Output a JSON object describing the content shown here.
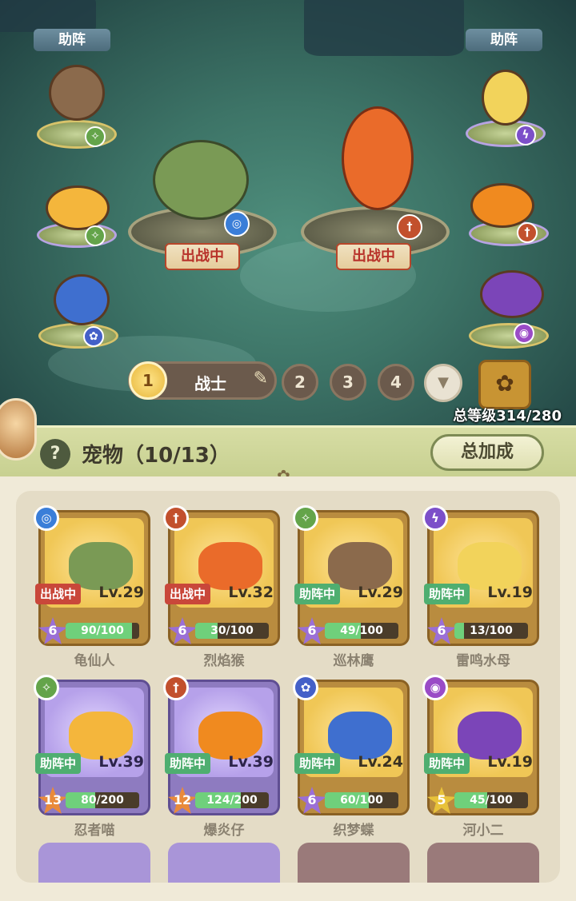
{
  "scene": {
    "assist_label": "助阵",
    "fight_label": "出战中",
    "team": {
      "selected_number": "1",
      "name": "战士",
      "other_numbers": [
        "2",
        "3",
        "4"
      ]
    },
    "total_level": "总等级314/280"
  },
  "panel": {
    "help": "?",
    "title": "宠物（10/13）",
    "bonus_button": "总加成"
  },
  "colors": {
    "fight": "#c9473a",
    "assist": "#4fae70",
    "exp_bar": "#6fd07b"
  },
  "pets": [
    {
      "name": "龟仙人",
      "status": "出战中",
      "level": "Lv.29",
      "star": "6",
      "exp": "90/100",
      "exp_frac": 0.9,
      "element_icon": "water-icon",
      "rarity": "gold"
    },
    {
      "name": "烈焰猴",
      "status": "出战中",
      "level": "Lv.32",
      "star": "6",
      "exp": "30/100",
      "exp_frac": 0.3,
      "element_icon": "fire-icon",
      "rarity": "gold"
    },
    {
      "name": "巡林鹰",
      "status": "助阵中",
      "level": "Lv.29",
      "star": "6",
      "exp": "49/100",
      "exp_frac": 0.49,
      "element_icon": "wind-icon",
      "rarity": "gold"
    },
    {
      "name": "雷鸣水母",
      "status": "助阵中",
      "level": "Lv.19",
      "star": "6",
      "exp": "13/100",
      "exp_frac": 0.13,
      "element_icon": "thunder-icon",
      "rarity": "gold"
    },
    {
      "name": "忍者喵",
      "status": "助阵中",
      "level": "Lv.39",
      "star": "13",
      "exp": "80/200",
      "exp_frac": 0.4,
      "element_icon": "wind-icon",
      "rarity": "purple"
    },
    {
      "name": "爆炎仔",
      "status": "助阵中",
      "level": "Lv.39",
      "star": "12",
      "exp": "124/200",
      "exp_frac": 0.62,
      "element_icon": "fire-icon",
      "rarity": "purple"
    },
    {
      "name": "织梦蝶",
      "status": "助阵中",
      "level": "Lv.24",
      "star": "6",
      "exp": "60/100",
      "exp_frac": 0.6,
      "element_icon": "paw-icon",
      "rarity": "gold"
    },
    {
      "name": "河小二",
      "status": "助阵中",
      "level": "Lv.19",
      "star": "5",
      "exp": "45/100",
      "exp_frac": 0.45,
      "element_icon": "ghost-icon",
      "rarity": "gold"
    }
  ]
}
